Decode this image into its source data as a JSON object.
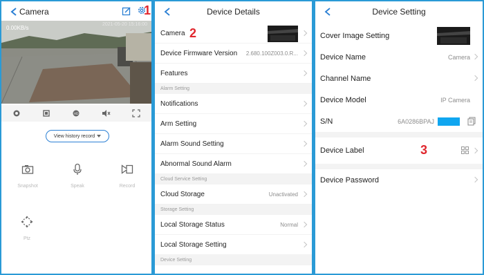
{
  "panel1": {
    "title": "Camera",
    "marker": "1",
    "video": {
      "speed": "0.00KB/s",
      "timestamp": "2021-05-20 15:16:00"
    },
    "history_button": "View history record",
    "tools": [
      {
        "label": "Snapshot",
        "icon": "camera-icon"
      },
      {
        "label": "Speak",
        "icon": "microphone-icon"
      },
      {
        "label": "Record",
        "icon": "video-record-icon"
      },
      {
        "label": "Ptz",
        "icon": "ptz-icon"
      }
    ]
  },
  "panel2": {
    "title": "Device Details",
    "marker": "2",
    "rows": {
      "camera": "Camera",
      "firmware": "Device Firmware Version",
      "firmware_value": "2.680.100Z003.0.R...",
      "features": "Features",
      "sect_alarm": "Alarm Setting",
      "notifications": "Notifications",
      "arm": "Arm Setting",
      "alarm_sound": "Alarm Sound Setting",
      "abnormal_sound": "Abnormal Sound Alarm",
      "sect_cloud": "Cloud Service Setting",
      "cloud_storage": "Cloud Storage",
      "cloud_storage_value": "Unactivated",
      "sect_storage": "Storage Setting",
      "local_status": "Local Storage Status",
      "local_status_value": "Normal",
      "local_setting": "Local Storage Setting",
      "sect_device": "Device Setting"
    }
  },
  "panel3": {
    "title": "Device Setting",
    "marker": "3",
    "rows": {
      "cover": "Cover Image Setting",
      "name": "Device Name",
      "name_value": "Camera",
      "channel": "Channel Name",
      "model": "Device Model",
      "model_value": "IP Camera",
      "sn": "S/N",
      "sn_value": "6A0286BPAJ",
      "label": "Device Label",
      "password": "Device Password"
    }
  },
  "colors": {
    "accent": "#2a7fd4",
    "marker": "#e0262d",
    "frame": "#2a9ad6"
  }
}
